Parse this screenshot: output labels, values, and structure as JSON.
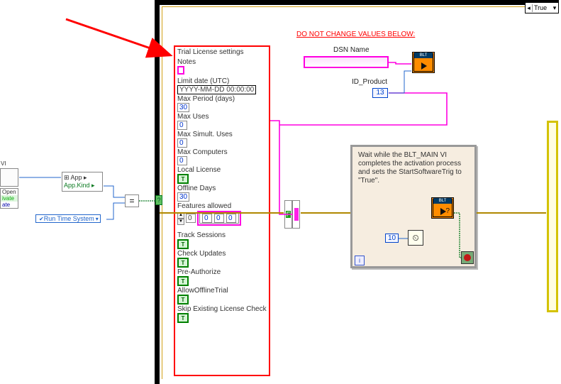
{
  "case_selector": {
    "value": "True"
  },
  "warning": "DO NOT CHANGE VALUES BELOW:",
  "dsn": {
    "label": "DSN Name",
    "value": ""
  },
  "id_product": {
    "label": "ID_Product",
    "value": "13"
  },
  "trial_panel": {
    "title": "Trial License settings",
    "notes_label": "Notes",
    "notes_value": "",
    "limit_date_label": "Limit date (UTC)",
    "limit_date_value": "YYYY-MM-DD 00:00:00",
    "max_period_label": "Max Period (days)",
    "max_period_value": "30",
    "max_uses_label": "Max Uses",
    "max_uses_value": "0",
    "max_simult_label": "Max Simult. Uses",
    "max_simult_value": "0",
    "max_computers_label": "Max Computers",
    "max_computers_value": "0",
    "local_license_label": "Local License",
    "local_license_value": "T",
    "offline_days_label": "Offline Days",
    "offline_days_value": "30",
    "features_label": "Features allowed",
    "features_index": "0",
    "features_values": [
      "0",
      "0",
      "0"
    ],
    "track_sessions_label": "Track Sessions",
    "track_sessions_value": "T",
    "check_updates_label": "Check Updates",
    "check_updates_value": "T",
    "pre_auth_label": "Pre-Authorize",
    "pre_auth_value": "T",
    "allow_offline_label": "AllowOfflineTrial",
    "allow_offline_value": "T",
    "skip_check_label": "Skip Existing License Check",
    "skip_check_value": "T"
  },
  "left": {
    "vi_label": "VI",
    "rows": {
      "open": "Open",
      "ivate": "ivate",
      "ate": "ate"
    },
    "app_handle": "⊞ App ▸",
    "app_kind": "App.Kind ▸",
    "runtime": "Run Time System"
  },
  "note": {
    "text": "Wait while the BLT_MAIN VI completes the activation process and sets the StartSoftwareTrig to \"True\"."
  },
  "const10": "10",
  "loop_i": "i",
  "blt_tag": "BLT"
}
